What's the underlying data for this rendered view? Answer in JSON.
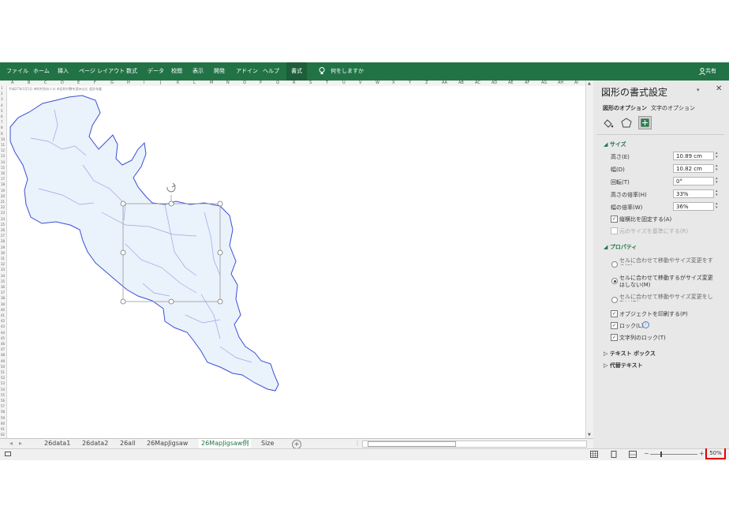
{
  "ribbon": {
    "tabs": [
      "ファイル",
      "ホーム",
      "挿入",
      "ページ レイアウト",
      "数式",
      "データ",
      "校閲",
      "表示",
      "開発",
      "アドイン",
      "ヘルプ"
    ],
    "active_tab": "書式",
    "tell_me": "何をしますか",
    "share": "共有"
  },
  "sheet": {
    "columns": [
      "A",
      "B",
      "C",
      "D",
      "E",
      "F",
      "G",
      "H",
      "I",
      "J",
      "K",
      "L",
      "M",
      "N",
      "O",
      "P",
      "Q",
      "R",
      "S",
      "T",
      "U",
      "V",
      "W",
      "X",
      "Y",
      "Z",
      "AA",
      "AB",
      "AC",
      "AD",
      "AE",
      "AF",
      "AG",
      "AH",
      "AI"
    ],
    "rows": [
      "1",
      "2",
      "3",
      "4",
      "5",
      "6",
      "7",
      "8",
      "9",
      "10",
      "11",
      "12",
      "13",
      "14",
      "15",
      "16",
      "17",
      "18",
      "19",
      "20",
      "21",
      "22",
      "23",
      "24",
      "25",
      "26",
      "27",
      "28",
      "29",
      "30",
      "31",
      "32",
      "33",
      "34",
      "35",
      "36",
      "37",
      "38",
      "39",
      "40",
      "41",
      "42",
      "43",
      "44",
      "45",
      "46",
      "47",
      "48",
      "49",
      "50",
      "51",
      "52",
      "53",
      "54",
      "55",
      "56",
      "57",
      "58",
      "59",
      "60",
      "61",
      "62"
    ],
    "cell_note": "平成27年1月1日  市町村別の人口  市区町村数を読み込む  会計年度"
  },
  "sheet_tabs": {
    "items": [
      "26data1",
      "26data2",
      "26all",
      "26MapJigsaw",
      "26MapJigsaw例",
      "Size"
    ],
    "active": "26MapJigsaw例",
    "add": "+"
  },
  "pane": {
    "title": "図形の書式設定",
    "tab_shape": "図形のオプション",
    "tab_text": "文字のオプション",
    "size_section": "サイズ",
    "height_label": "高さ(E)",
    "height_value": "10.89 cm",
    "width_label": "幅(D)",
    "width_value": "10.82 cm",
    "rotation_label": "回転(T)",
    "rotation_value": "0°",
    "scale_h_label": "高さの倍率(H)",
    "scale_h_value": "33%",
    "scale_w_label": "幅の倍率(W)",
    "scale_w_value": "36%",
    "lock_aspect": "縦横比を固定する(A)",
    "relative_original": "元のサイズを基準にする(R)",
    "props_section": "プロパティ",
    "radio1": "セルに合わせて移動やサイズ変更をする(S)",
    "radio2": "セルに合わせて移動するがサイズ変更はしない(M)",
    "radio3": "セルに合わせて移動やサイズ変更をしない(D)",
    "print_obj": "オブジェクトを印刷する(P)",
    "lock": "ロック(L)",
    "text_lock": "文字列のロック(T)",
    "textbox_section": "テキスト ボックス",
    "alt_text_section": "代替テキスト"
  },
  "status": {
    "zoom": "50%"
  },
  "colors": {
    "ribbon": "#217346",
    "map_fill": "#eaf2fb",
    "map_stroke": "#3a4fd6",
    "highlight": "#e00000"
  }
}
